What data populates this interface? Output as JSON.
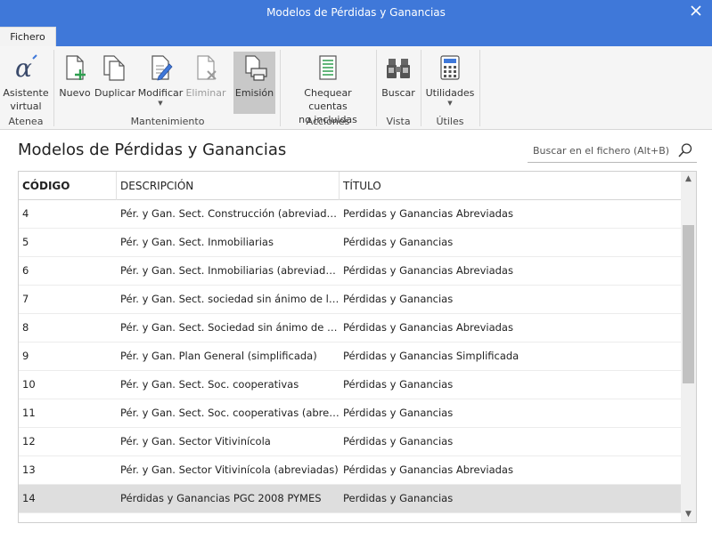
{
  "window": {
    "title": "Modelos de Pérdidas y Ganancias"
  },
  "tabs": {
    "file": "Fichero"
  },
  "ribbon": {
    "assistant": {
      "line1": "Asistente",
      "line2": "virtual"
    },
    "new": "Nuevo",
    "duplicate": "Duplicar",
    "modify": "Modificar",
    "delete": "Eliminar",
    "emission": "Emisión",
    "check": {
      "line1": "Chequear cuentas",
      "line2": "no incluidas"
    },
    "search": "Buscar",
    "utilities": "Utilidades",
    "groups": {
      "atenea": "Atenea",
      "maintenance": "Mantenimiento",
      "actions": "Acciones",
      "view": "Vista",
      "useful": "Útiles"
    }
  },
  "main": {
    "heading": "Modelos de Pérdidas y Ganancias",
    "search_placeholder": "Buscar en el fichero (Alt+B)"
  },
  "table": {
    "columns": [
      "CÓDIGO",
      "DESCRIPCIÓN",
      "TÍTULO"
    ],
    "rows": [
      [
        "4",
        "Pér. y Gan. Sect. Construcción (abreviadas)",
        "Perdidas y Ganancias Abreviadas"
      ],
      [
        "5",
        "Pér. y Gan. Sect. Inmobiliarias",
        "Pérdidas y Ganancias"
      ],
      [
        "6",
        "Pér. y Gan. Sect. Inmobiliarias (abreviadas)",
        "Pérdidas y Ganancias Abreviadas"
      ],
      [
        "7",
        "Pér. y Gan. Sect. sociedad sin ánimo de lucro.",
        "Pérdidas y Ganancias"
      ],
      [
        "8",
        "Pér. y Gan. Sect. Sociedad sin ánimo de lucr...",
        "Pérdidas y Ganancias Abreviadas"
      ],
      [
        "9",
        "Pér. y Gan. Plan General (simplificada)",
        "Pérdidas y Ganancias Simplificada"
      ],
      [
        "10",
        "Pér. y Gan. Sect. Soc. cooperativas",
        "Pérdidas y Ganancias"
      ],
      [
        "11",
        "Pér. y Gan. Sect. Soc. cooperativas (abreviad...",
        "Pérdidas y Ganancias"
      ],
      [
        "12",
        "Pér. y Gan. Sector Vitivinícola",
        "Pérdidas y Ganancias"
      ],
      [
        "13",
        "Pér. y Gan. Sector Vitivinícola (abreviadas)",
        "Pérdidas y Ganancias Abreviadas"
      ],
      [
        "14",
        "Pérdidas y Ganancias PGC 2008 PYMES",
        "Perdidas y Ganancias"
      ]
    ],
    "selected_row": 10
  },
  "colors": {
    "titlebar": "#3f78d9",
    "selection": "#dedede",
    "accent_green": "#2e9e4f"
  },
  "icons": [
    "alpha-assistant-icon",
    "new-document-icon",
    "duplicate-icon",
    "edit-document-icon",
    "delete-document-icon",
    "print-emission-icon",
    "checklist-icon",
    "binoculars-icon",
    "calculator-icon",
    "search-icon",
    "close-icon"
  ]
}
